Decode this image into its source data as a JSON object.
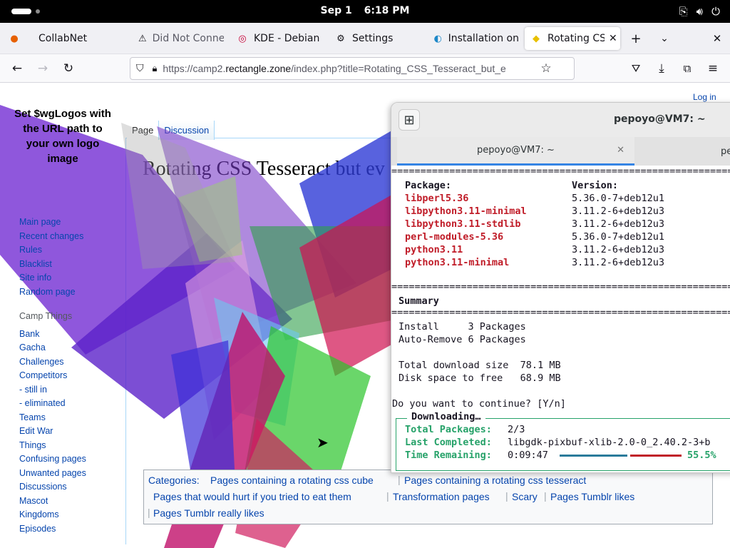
{
  "system_bar": {
    "date": "Sep 1",
    "time": "6:18 PM"
  },
  "browser": {
    "tabs": [
      {
        "title": "CollabNet",
        "icon": "firefox-icon"
      },
      {
        "title": "Did Not Conne",
        "icon": "warning-icon"
      },
      {
        "title": "KDE - Debian",
        "icon": "debian-icon"
      },
      {
        "title": "Settings",
        "icon": "gear-icon"
      },
      {
        "title": "Installation on",
        "icon": "globe-icon"
      },
      {
        "title": "Rotating CSS",
        "icon": "rotating-page-icon",
        "active": true
      }
    ],
    "url_prefix": "https://camp2.",
    "url_domain": "rectangle.zone",
    "url_suffix": "/index.php?title=Rotating_CSS_Tesseract_but_e"
  },
  "page": {
    "logo_text": "Set $wgLogos with the URL path to your own logo image",
    "login": "Log in",
    "tabs": {
      "page": "Page",
      "discussion": "Discussion"
    },
    "title": "Rotating CSS Tesseract but ev",
    "sidebar": {
      "nav": [
        "Main page",
        "Recent changes",
        "Rules",
        "Blacklist",
        "Site info",
        "Random page"
      ],
      "section_header": "Camp Things",
      "camp": [
        "Bank",
        "Gacha",
        "Challenges",
        "Competitors",
        "- still in",
        "- eliminated",
        "Teams",
        "Edit War",
        "Things",
        "Confusing pages",
        "Unwanted pages",
        "Discussions",
        "Mascot",
        "Kingdoms",
        "Episodes"
      ]
    },
    "categories": {
      "label": "Categories:",
      "items": [
        "Pages containing a rotating css cube",
        "Pages containing a rotating css tesseract",
        "Pages that would hurt if you tried to eat them",
        "Transformation pages",
        "Scary",
        "Pages Tumblr likes",
        "Pages Tumblr really likes"
      ]
    }
  },
  "terminal": {
    "window_title": "pepoyo@VM7: ~",
    "tab_active": "pepoyo@VM7: ~",
    "tab_second": "pe",
    "separator": "=============================================================",
    "header_package": "Package:",
    "header_version": "Version:",
    "packages": [
      {
        "name": "libperl5.36",
        "version": "5.36.0-7+deb12u1"
      },
      {
        "name": "libpython3.11-minimal",
        "version": "3.11.2-6+deb12u3"
      },
      {
        "name": "libpython3.11-stdlib",
        "version": "3.11.2-6+deb12u3"
      },
      {
        "name": "perl-modules-5.36",
        "version": "5.36.0-7+deb12u1"
      },
      {
        "name": "python3.11",
        "version": "3.11.2-6+deb12u3"
      },
      {
        "name": "python3.11-minimal",
        "version": "3.11.2-6+deb12u3"
      }
    ],
    "summary": "Summary",
    "install": "Install     3 Packages",
    "auto_remove": "Auto-Remove 6 Packages",
    "download_size": "Total download size  78.1 MB",
    "disk_space": "Disk space to free   68.9 MB",
    "prompt": "Do you want to continue? [Y/n]",
    "downloading": "Downloading…",
    "total_packages_label": "Total Packages:",
    "total_packages_value": "2/3",
    "last_completed_label": "Last Completed:",
    "last_completed_value": "libgdk-pixbuf-xlib-2.0-0_2.40.2-3+b",
    "time_remaining_label": "Time Remaining:",
    "time_remaining_value": "0:09:47",
    "progress_percent": "55.5%"
  }
}
